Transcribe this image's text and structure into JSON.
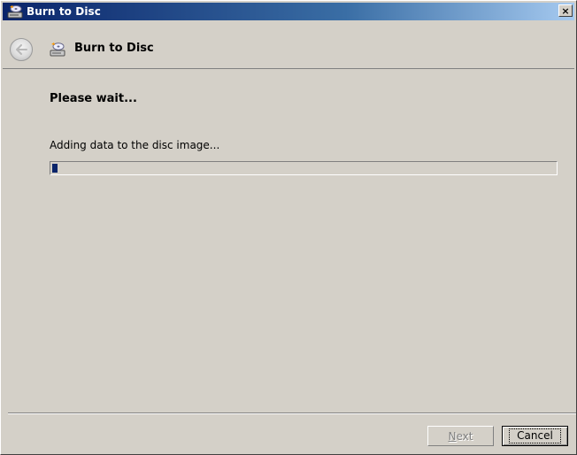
{
  "window": {
    "title": "Burn to Disc",
    "close_glyph": "×",
    "icon": "burn-disc-icon"
  },
  "header": {
    "back_icon": "back-arrow-icon",
    "title": "Burn to Disc",
    "icon": "burn-disc-icon"
  },
  "body": {
    "heading": "Please wait...",
    "status": "Adding data to the disc image...",
    "progress_fraction": 0.01
  },
  "footer": {
    "next_label_mnemonic": "N",
    "next_label_rest": "ext",
    "next_enabled": false,
    "cancel_label": "Cancel"
  },
  "colors": {
    "title_gradient_start": "#0a246a",
    "title_gradient_end": "#a6caf0",
    "progress_fill": "#0a246a",
    "face": "#d4d0c8"
  }
}
